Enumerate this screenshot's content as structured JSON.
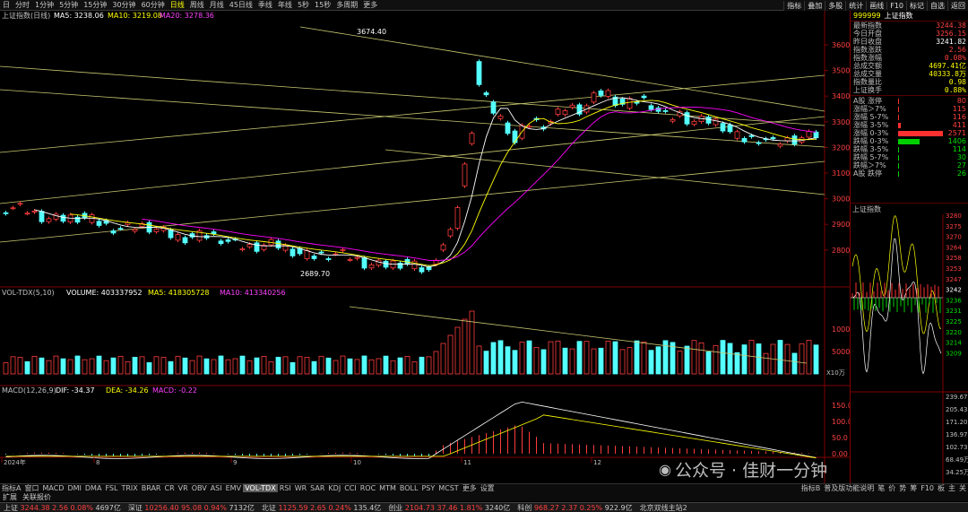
{
  "topbar": {
    "items": [
      "日",
      "分时",
      "1分钟",
      "5分钟",
      "15分钟",
      "30分钟",
      "60分钟",
      "日线",
      "周线",
      "月线",
      "45日线",
      "季线",
      "年线",
      "5秒",
      "15秒",
      "多周期",
      "更多"
    ],
    "active": 7,
    "right": [
      "指标",
      "叠加",
      "多股",
      "统计",
      "画线",
      "F10",
      "标记",
      "自选",
      "返回"
    ]
  },
  "kline": {
    "title": "上证指数(日线)",
    "ma5_label": "MA5: 3238.06",
    "ma10_label": "MA10: 3219.08",
    "ma20_label": "MA20: 3278.36",
    "high_label": "3674.40",
    "low_label": "2689.70",
    "yticks": [
      "3600",
      "3500",
      "3400",
      "3300",
      "3200",
      "3100",
      "3000",
      "2900",
      "2800"
    ],
    "axis_months": [
      "2024年",
      "8",
      "9",
      "10",
      "11",
      "12"
    ]
  },
  "vol": {
    "title": "VOL-TDX(5,10)",
    "volume": "VOLUME: 403337952",
    "ma5": "MA5: 418305728",
    "ma10": "MA10: 413340256",
    "yticks": [
      "10000",
      "5000"
    ],
    "unit": "X10万"
  },
  "macd": {
    "title": "MACD(12,26,9)",
    "dif": "DIF: -34.37",
    "dea": "DEA: -34.26",
    "macd": "MACD: -0.22",
    "yticks": [
      "150.0",
      "100.0",
      "50.0",
      "0.00"
    ]
  },
  "quote": {
    "code": "999999",
    "name": "上证指数",
    "rows": [
      [
        "最新指数",
        "3244.38",
        "red"
      ],
      [
        "今日开盘",
        "3256.15",
        "red"
      ],
      [
        "昨日收盘",
        "3241.82",
        "white"
      ],
      [
        "指数涨跌",
        "2.56",
        "red"
      ],
      [
        "指数涨幅",
        "0.08%",
        "red"
      ],
      [
        "总成交额",
        "4697.41亿",
        "yel"
      ],
      [
        "总成交量",
        "40333.8万",
        "yel"
      ],
      [
        "指数量比",
        "0.98",
        "yel"
      ],
      [
        "上证换手",
        "0.88%",
        "yel"
      ]
    ],
    "breadth": [
      [
        "A股 涨停",
        "80",
        "red",
        1.5
      ],
      [
        "涨幅＞7%",
        "115",
        "red",
        2
      ],
      [
        "涨幅 5-7%",
        "116",
        "red",
        2
      ],
      [
        "涨幅 3-5%",
        "411",
        "red",
        5
      ],
      [
        "涨幅 0-3%",
        "2571",
        "red",
        100
      ],
      [
        "跌幅 0-3%",
        "1406",
        "green",
        48
      ],
      [
        "跌幅 3-5%",
        "114",
        "green",
        2
      ],
      [
        "跌幅 5-7%",
        "30",
        "green",
        1
      ],
      [
        "跌幅＞7%",
        "27",
        "green",
        1
      ],
      [
        "A股 跌停",
        "26",
        "green",
        1
      ]
    ]
  },
  "intraday": {
    "title": "上证指数",
    "yticks": [
      "3280",
      "3275",
      "3270",
      "3264",
      "3258",
      "3253",
      "3247",
      "3242",
      "3236",
      "3231",
      "3225",
      "3220",
      "3214",
      "3209"
    ],
    "vticks": [
      "239.67万",
      "205.43万",
      "171.20万",
      "136.97万",
      "102.73万",
      "68.49万",
      "34.25万"
    ]
  },
  "bottom": {
    "items": [
      "指标A",
      "窗口",
      "MACD",
      "DMI",
      "DMA",
      "FSL",
      "TRIX",
      "BRAR",
      "CR",
      "VR",
      "OBV",
      "ASI",
      "EMV",
      "VOL-TDX",
      "RSI",
      "WR",
      "SAR",
      "KDJ",
      "CCI",
      "ROC",
      "MTM",
      "BOLL",
      "PSY",
      "MCST",
      "更多",
      "设置"
    ],
    "active": 13,
    "right": [
      "指标B",
      "普及版功能说明",
      "笔",
      "价",
      "势",
      "筹",
      "F10",
      "板",
      "主",
      "关"
    ]
  },
  "bottom2": {
    "items": [
      "扩展",
      "关联报价"
    ]
  },
  "status": {
    "items": [
      [
        "上证",
        "3244.38",
        "2.56",
        "0.08%",
        "4697亿"
      ],
      [
        "深证",
        "10256.40",
        "95.08",
        "0.94%",
        "7132亿"
      ],
      [
        "北证",
        "1125.59",
        "2.65",
        "0.24%",
        "135.4亿"
      ],
      [
        "创业",
        "2104.73",
        "37.46",
        "1.81%",
        "3240亿"
      ],
      [
        "科创",
        "968.27",
        "2.37",
        "0.25%",
        "922.9亿"
      ]
    ],
    "site": "北京双线主站2"
  },
  "watermark": "公众号 · 佳财一分钟",
  "colors": {
    "up": "#ff3c3c",
    "down": "#54ffff",
    "ma5": "#ffffff",
    "ma10": "#ffff00",
    "ma20": "#ff00ff",
    "trend": "#c8c870"
  }
}
